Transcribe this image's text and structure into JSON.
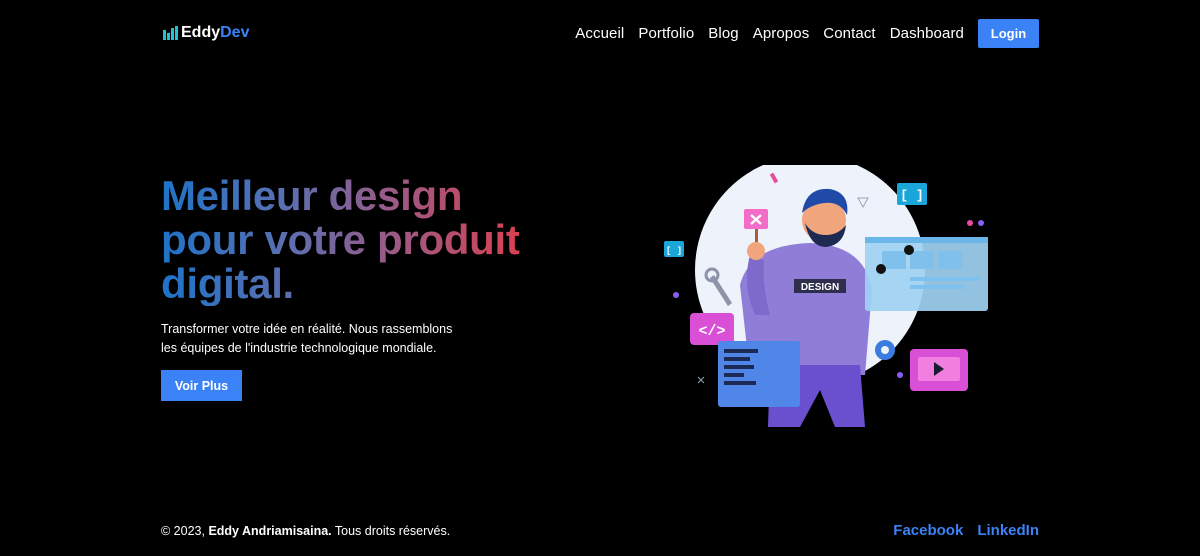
{
  "nav": {
    "logo_part1": "Eddy",
    "logo_part2": "Dev",
    "links": [
      "Accueil",
      "Portfolio",
      "Blog",
      "Apropos",
      "Contact",
      "Dashboard"
    ],
    "login": "Login"
  },
  "hero": {
    "title_lines": [
      "Meilleur design",
      "pour votre produit",
      "digital."
    ],
    "description_lines": [
      "Transformer votre idée en réalité. Nous rassemblons",
      "les équipes de l'industrie technologique mondiale."
    ],
    "cta": "Voir Plus"
  },
  "illustration": {
    "shirt_label": "DESIGN",
    "code_tag": "</>",
    "bracket_tag": "[ ]"
  },
  "footer": {
    "copyright_prefix": "© 2023,",
    "author": "Eddy Andriamisaina.",
    "rights": "Tous droits réservés.",
    "social": [
      "Facebook",
      "LinkedIn"
    ]
  },
  "colors": {
    "accent": "#3b82f6",
    "background": "#000000"
  }
}
